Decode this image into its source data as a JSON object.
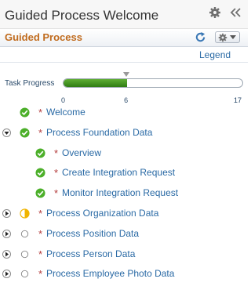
{
  "header": {
    "title": "Guided Process Welcome",
    "settings_icon": "gear-icon",
    "collapse_icon": "double-chevron-left-icon"
  },
  "subheader": {
    "title": "Guided Process",
    "refresh_icon": "refresh-icon",
    "actions_icon": "gear-dropdown-icon"
  },
  "legend_label": "Legend",
  "progress": {
    "label": "Task Progress",
    "min": 0,
    "current": 6,
    "max": 17,
    "min_label": "0",
    "current_label": "6",
    "max_label": "17"
  },
  "steps": [
    {
      "label": "Welcome",
      "required_mark": "*",
      "status": "complete",
      "expander": "none",
      "indent": 0
    },
    {
      "label": "Process Foundation Data",
      "required_mark": "*",
      "status": "complete",
      "expander": "expanded",
      "indent": 0
    },
    {
      "label": "Overview",
      "required_mark": "*",
      "status": "complete",
      "expander": "none",
      "indent": 1
    },
    {
      "label": "Create Integration Request",
      "required_mark": "*",
      "status": "complete",
      "expander": "none",
      "indent": 1
    },
    {
      "label": "Monitor Integration Request",
      "required_mark": "*",
      "status": "complete",
      "expander": "none",
      "indent": 1
    },
    {
      "label": "Process Organization Data",
      "required_mark": "*",
      "status": "in-progress",
      "expander": "collapsed",
      "indent": 0
    },
    {
      "label": "Process Position Data",
      "required_mark": "*",
      "status": "not-started",
      "expander": "collapsed",
      "indent": 0
    },
    {
      "label": "Process Person Data",
      "required_mark": "*",
      "status": "not-started",
      "expander": "collapsed",
      "indent": 0
    },
    {
      "label": "Process Employee Photo Data",
      "required_mark": "*",
      "status": "not-started",
      "expander": "collapsed",
      "indent": 0
    }
  ],
  "colors": {
    "accent_title": "#c06b1e",
    "link": "#2a6aa5",
    "complete": "#4caf2a",
    "in_progress": "#f0b400",
    "required": "#b33a3a"
  }
}
